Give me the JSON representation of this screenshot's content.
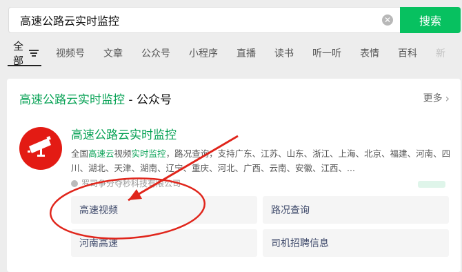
{
  "search": {
    "query": "高速公路云实时监控",
    "button_label": "搜索"
  },
  "tabs": {
    "all_label": "全部",
    "items": [
      "视频号",
      "文章",
      "公众号",
      "小程序",
      "直播",
      "读书",
      "听一听",
      "表情",
      "百科"
    ],
    "overflow_label": "新"
  },
  "card": {
    "title_highlight": "高速公路云实时监控",
    "title_suffix": " - 公众号",
    "more_label": "更多",
    "account": {
      "name": "高速公路云实时监控",
      "desc_prefix": "全国",
      "desc_em1": "高速云",
      "desc_mid1": "视频",
      "desc_em2": "实时监控",
      "desc_rest": "，路况查询，支持广东、江苏、山东、浙江、上海、北京、福建、河南、四川、湖北、天津、湖南、辽宁、重庆、河北、广西、云南、安徽、江西、...",
      "company": "罗司争分夺秒科技有限公司"
    },
    "menu": [
      "高速视频",
      "路况查询",
      "河南高速",
      "司机招聘信息"
    ]
  },
  "colors": {
    "accent": "#07c160",
    "highlight_text": "#07a255",
    "avatar_bg": "#e31b14",
    "annotation": "#e0251b"
  }
}
